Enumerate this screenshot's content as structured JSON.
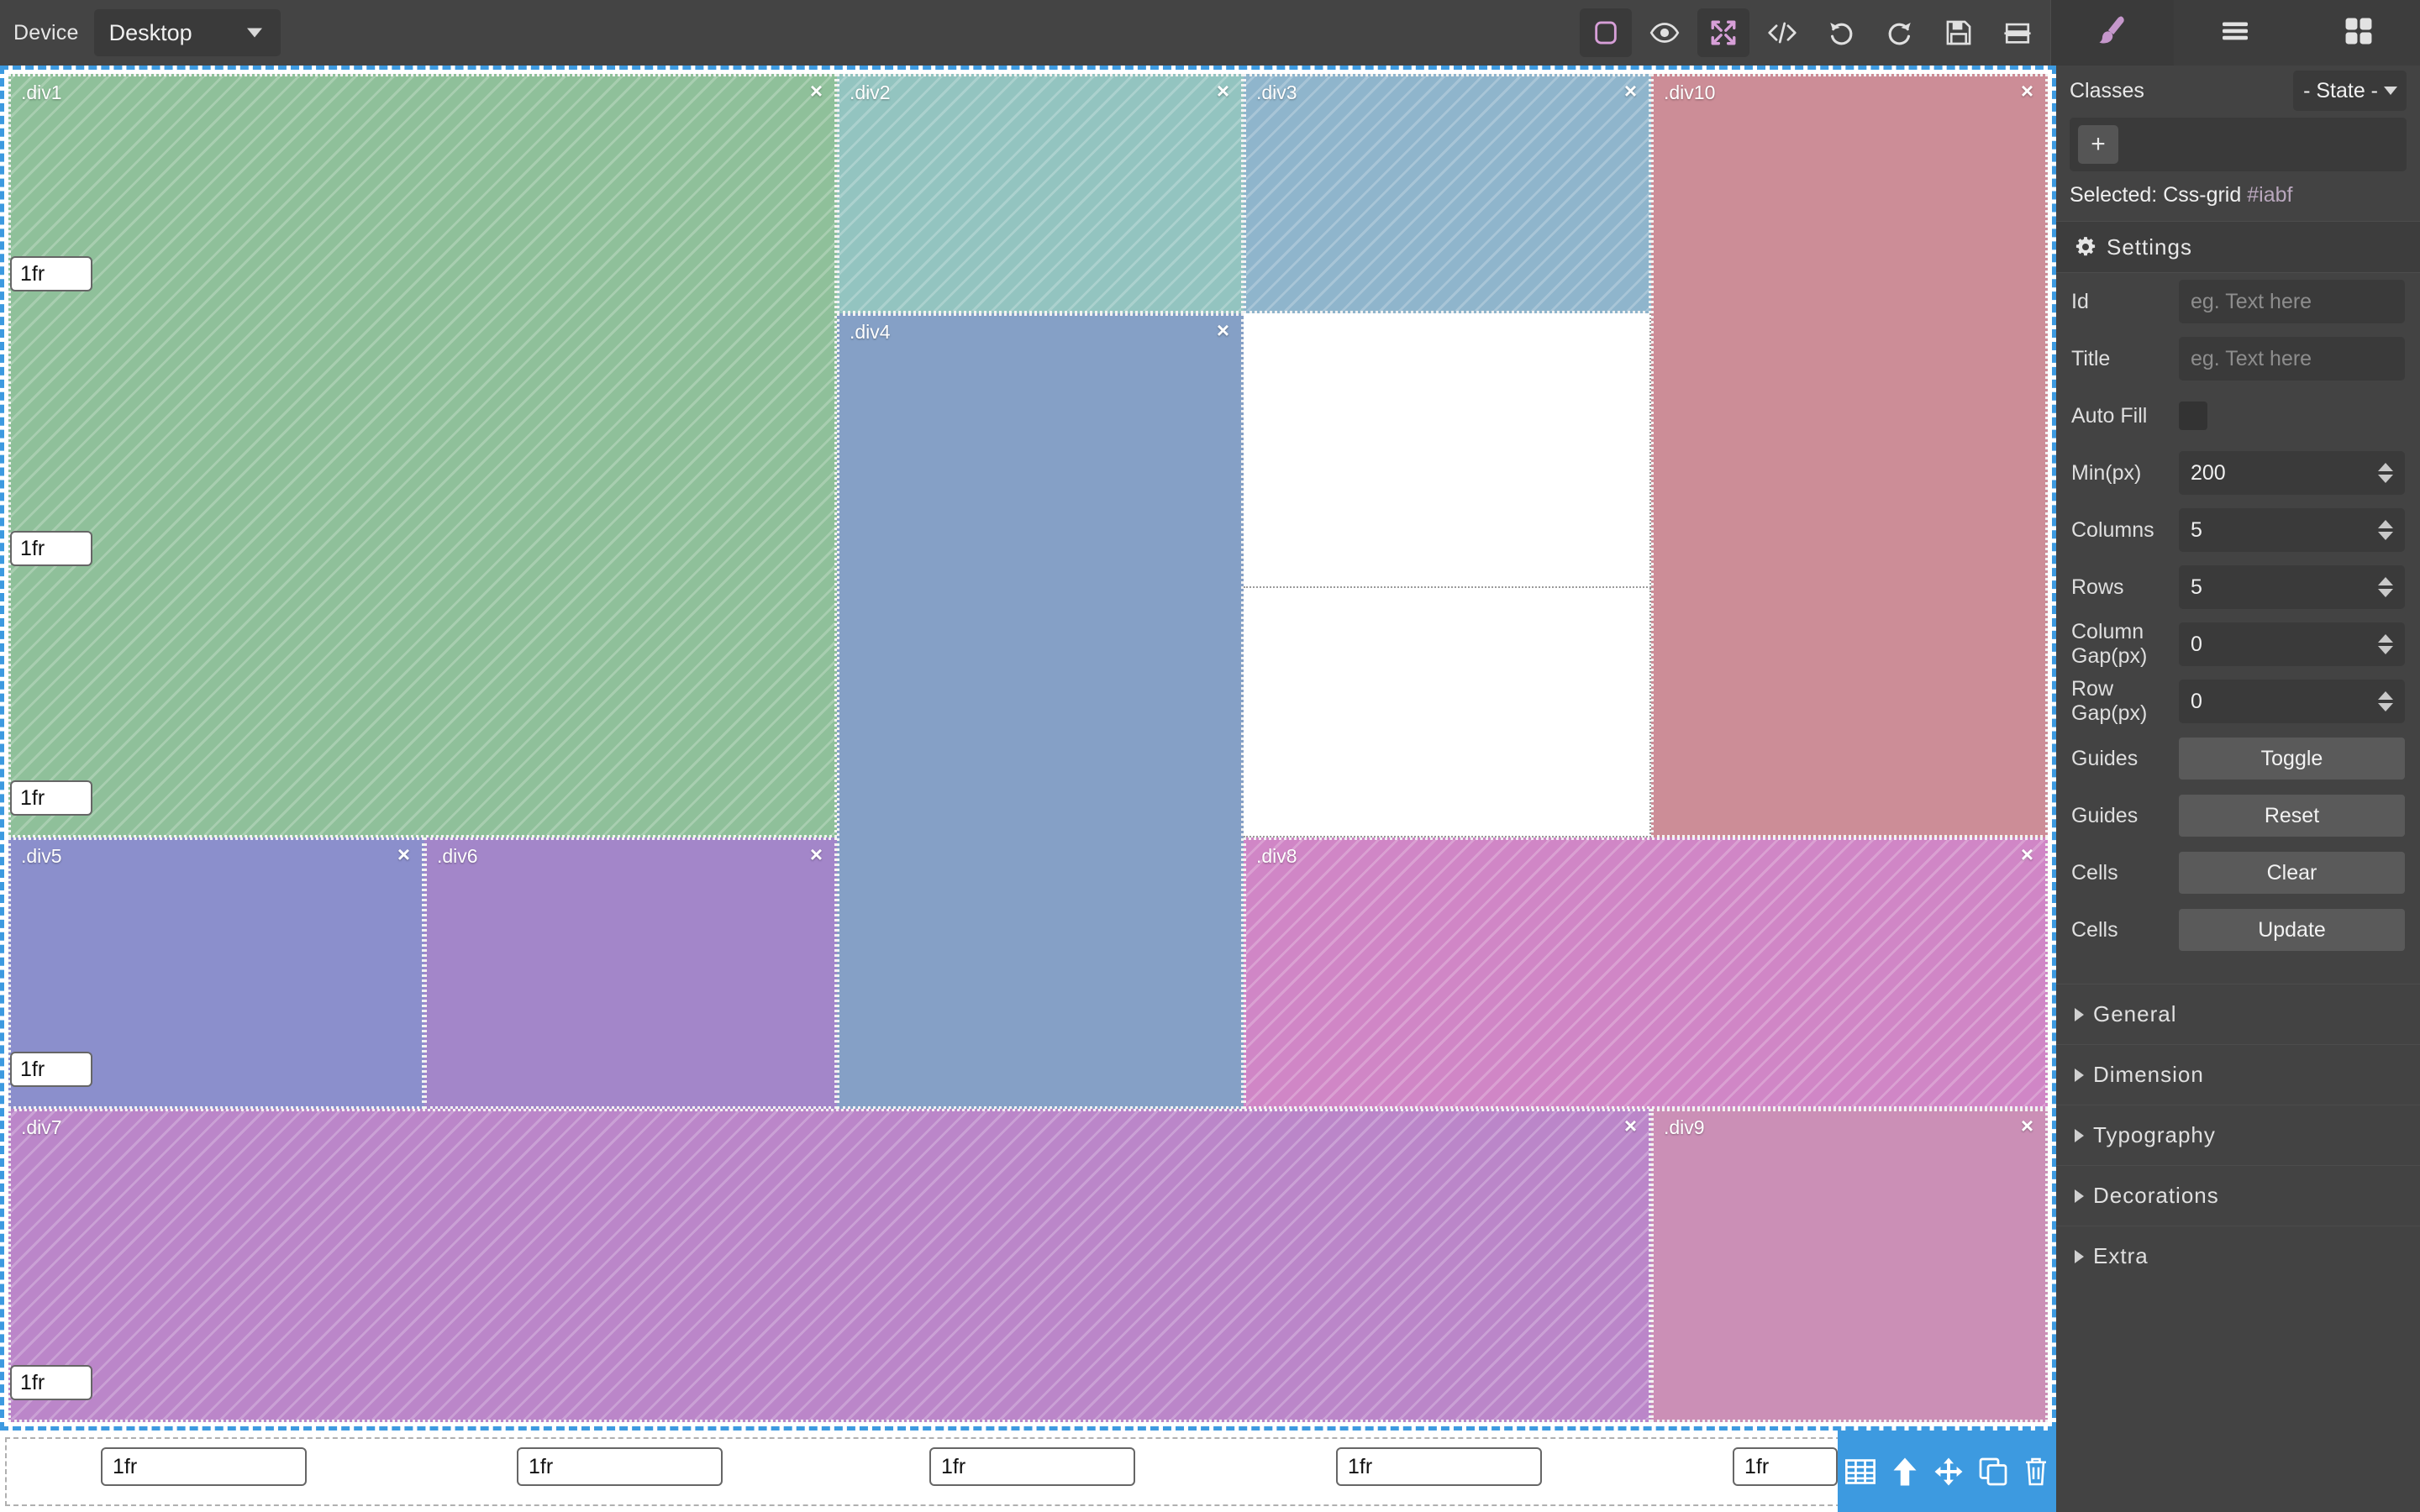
{
  "topbar": {
    "device_label": "Device",
    "device_value": "Desktop",
    "tools": [
      {
        "name": "rounded-rect-icon",
        "title": "Borders"
      },
      {
        "name": "eye-icon",
        "title": "Preview"
      },
      {
        "name": "expand-icon",
        "title": "Resize"
      },
      {
        "name": "code-icon",
        "title": "Code"
      },
      {
        "name": "undo-icon",
        "title": "Undo"
      },
      {
        "name": "redo-icon",
        "title": "Redo"
      },
      {
        "name": "save-icon",
        "title": "Save"
      },
      {
        "name": "layout-icon",
        "title": "Layout"
      }
    ],
    "right_tabs": [
      {
        "name": "brush-icon",
        "title": "Style"
      },
      {
        "name": "hamburger-icon",
        "title": "Menu"
      },
      {
        "name": "grid-apps-icon",
        "title": "Components"
      }
    ]
  },
  "canvas": {
    "row_sizes": [
      "1fr",
      "1fr",
      "1fr",
      "1fr",
      "1fr"
    ],
    "col_sizes": [
      "1fr",
      "1fr",
      "1fr",
      "1fr",
      "1fr"
    ],
    "close_label": "×",
    "blocks": [
      {
        "label": ".div1",
        "color": "#8fc09a",
        "striped": true,
        "col": "1 / 3",
        "row": "1 / 4"
      },
      {
        "label": ".div2",
        "color": "#93c4c0",
        "striped": true,
        "col": "3 / 4",
        "row": "1 / 2"
      },
      {
        "label": ".div3",
        "color": "#8fb5cc",
        "striped": true,
        "col": "4 / 5",
        "row": "1 / 2"
      },
      {
        "label": ".div10",
        "color": "#cc8d97",
        "striped": false,
        "col": "5 / 6",
        "row": "1 / 4"
      },
      {
        "label": ".div4",
        "color": "#85a0c6",
        "striped": false,
        "col": "3 / 4",
        "row": "2 / 5"
      },
      {
        "label": ".div5",
        "color": "#8b8fcc",
        "striped": false,
        "col": "1 / 2",
        "row": "4 / 5"
      },
      {
        "label": ".div6",
        "color": "#a386c9",
        "striped": false,
        "col": "2 / 3",
        "row": "4 / 5"
      },
      {
        "label": ".div8",
        "color": "#d086c6",
        "striped": true,
        "col": "4 / 6",
        "row": "4 / 5"
      },
      {
        "label": ".div7",
        "color": "#bb86c9",
        "striped": true,
        "col": "1 / 5",
        "row": "5 / 6"
      },
      {
        "label": ".div9",
        "color": "#cb8fb6",
        "striped": false,
        "col": "5 / 6",
        "row": "5 / 6"
      }
    ],
    "bottom_tools": [
      {
        "name": "table-icon"
      },
      {
        "name": "arrow-up-icon"
      },
      {
        "name": "move-icon"
      },
      {
        "name": "duplicate-icon"
      },
      {
        "name": "trash-icon"
      }
    ]
  },
  "panel": {
    "classes_label": "Classes",
    "state_value": "- State -",
    "add_class_label": "+",
    "selected_prefix": "Selected:",
    "selected_name": "Css-grid",
    "selected_id": "#iabf",
    "settings_title": "Settings",
    "fields": [
      {
        "label": "Id",
        "type": "text",
        "value": "",
        "placeholder": "eg. Text here"
      },
      {
        "label": "Title",
        "type": "text",
        "value": "",
        "placeholder": "eg. Text here"
      },
      {
        "label": "Auto Fill",
        "type": "check",
        "value": "",
        "checked": false
      },
      {
        "label": "Min(px)",
        "type": "number",
        "value": "200"
      },
      {
        "label": "Columns",
        "type": "number",
        "value": "5"
      },
      {
        "label": "Rows",
        "type": "number",
        "value": "5"
      },
      {
        "label": "Column Gap(px)",
        "type": "number",
        "value": "0"
      },
      {
        "label": "Row Gap(px)",
        "type": "number",
        "value": "0"
      },
      {
        "label": "Guides",
        "type": "button",
        "value": "Toggle"
      },
      {
        "label": "Guides",
        "type": "button",
        "value": "Reset"
      },
      {
        "label": "Cells",
        "type": "button",
        "value": "Clear"
      },
      {
        "label": "Cells",
        "type": "button",
        "value": "Update"
      }
    ],
    "accordions": [
      "General",
      "Dimension",
      "Typography",
      "Decorations",
      "Extra"
    ]
  }
}
